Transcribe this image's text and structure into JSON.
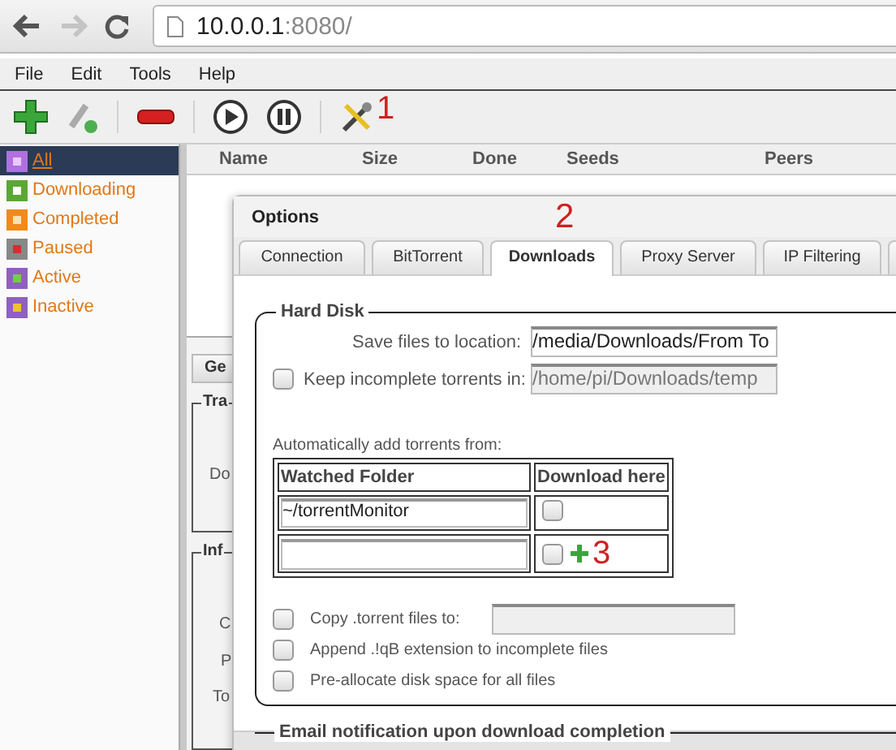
{
  "browser": {
    "host": "10.0.0.1",
    "port": ":8080/"
  },
  "menu": [
    "File",
    "Edit",
    "Tools",
    "Help"
  ],
  "toolbar": {
    "annotation": "1"
  },
  "sidebar": {
    "items": [
      {
        "label": "All",
        "kind": "all",
        "selected": true
      },
      {
        "label": "Downloading",
        "kind": "downloading",
        "selected": false
      },
      {
        "label": "Completed",
        "kind": "completed",
        "selected": false
      },
      {
        "label": "Paused",
        "kind": "paused",
        "selected": false
      },
      {
        "label": "Active",
        "kind": "active",
        "selected": false
      },
      {
        "label": "Inactive",
        "kind": "inactive",
        "selected": false
      }
    ]
  },
  "table": {
    "columns": [
      "Name",
      "Size",
      "Done",
      "Seeds",
      "Peers"
    ]
  },
  "details": {
    "tab": "Ge",
    "transfer_legend": "Tra",
    "transfer_label": "Do",
    "info_legend": "Inf",
    "info_labels": [
      "C",
      "P",
      "To"
    ]
  },
  "dialog": {
    "title": "Options",
    "annotation": "2",
    "tabs": [
      {
        "label": "Connection",
        "selected": false
      },
      {
        "label": "BitTorrent",
        "selected": false
      },
      {
        "label": "Downloads",
        "selected": true
      },
      {
        "label": "Proxy Server",
        "selected": false
      },
      {
        "label": "IP Filtering",
        "selected": false
      }
    ],
    "hard_disk": {
      "legend": "Hard Disk",
      "save_label": "Save files to location:",
      "save_value": "/media/Downloads/From To",
      "keep": {
        "label": "Keep incomplete torrents in:",
        "checked": false,
        "value": "/home/pi/Downloads/temp"
      },
      "auto_label": "Automatically add torrents from:",
      "watched": {
        "columns": [
          "Watched Folder",
          "Download here"
        ],
        "rows": [
          {
            "folder": "~/torrentMonitor",
            "download_here": false
          }
        ],
        "new_row": {
          "download_here": false,
          "annotation": "3"
        }
      },
      "options": [
        {
          "kind": "field",
          "label": "Copy .torrent files to:",
          "checked": false
        },
        {
          "kind": "plain",
          "label": "Append .!qB extension to incomplete files",
          "checked": false
        },
        {
          "kind": "plain",
          "label": "Pre-allocate disk space for all files",
          "checked": false
        }
      ]
    },
    "next_legend": "Email notification upon download completion"
  }
}
